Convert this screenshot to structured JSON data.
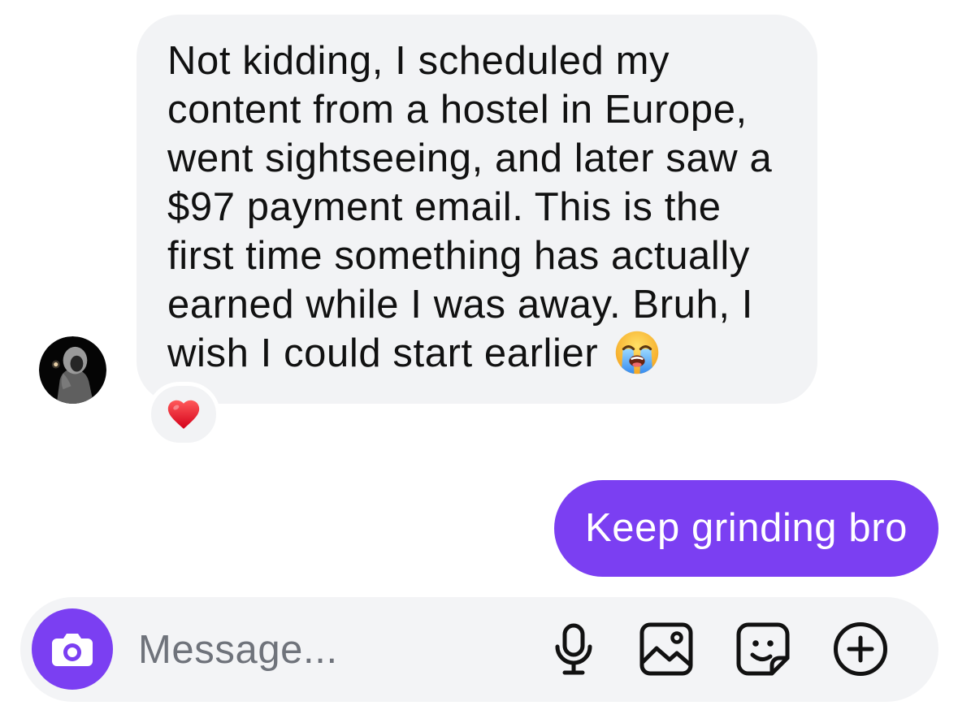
{
  "thread": {
    "incoming": {
      "avatar_icon": "profile-photo",
      "lines": [
        "Not kidding, I scheduled my",
        "content from a hostel in Europe,",
        "went sightseeing, and later saw a",
        "$97 payment email. This is the",
        "first time something has actually",
        "earned while I was away. Bruh, I",
        "wish I could start earlier"
      ],
      "end_emoji_icon": "loudly-crying-face-emoji",
      "reaction_icon": "red-heart-emoji"
    },
    "outgoing": {
      "text": "Keep grinding bro"
    }
  },
  "composer": {
    "placeholder": "Message...",
    "icons": {
      "camera": "camera-icon",
      "voice": "microphone-icon",
      "gallery": "image-icon",
      "sticker": "sticker-icon",
      "more": "plus-circle-icon"
    }
  },
  "colors": {
    "accent": "#7b3ff2",
    "bubble": "#f2f3f5",
    "composer": "#f3f4f6",
    "ink": "#111111",
    "placeholder": "#6f737b"
  }
}
